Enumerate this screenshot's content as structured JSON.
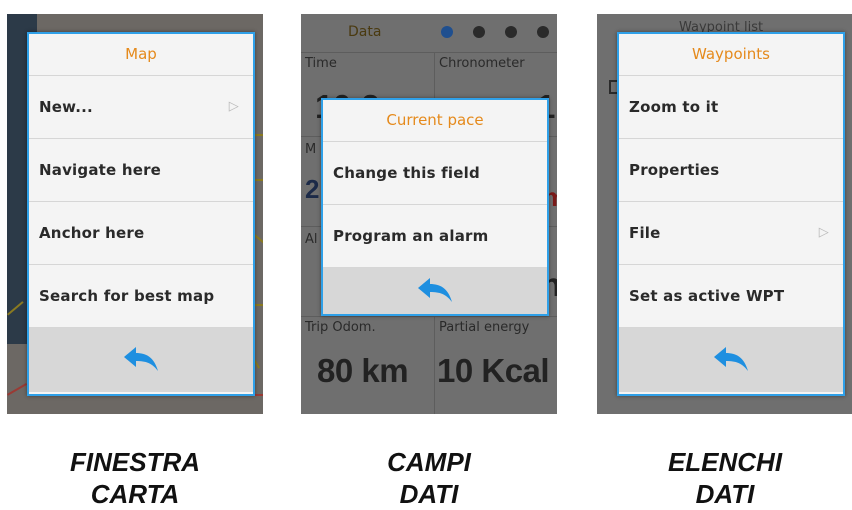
{
  "panels": [
    {
      "dialog_title": "Map",
      "items": [
        {
          "label": "New...",
          "has_submenu": true
        },
        {
          "label": "Navigate here",
          "has_submenu": false
        },
        {
          "label": "Anchor here",
          "has_submenu": false
        },
        {
          "label": "Search for best map",
          "has_submenu": false
        }
      ],
      "caption": [
        "FINESTRA",
        "CARTA"
      ]
    },
    {
      "background": {
        "header": "Data",
        "page_dots": 4,
        "active_dot": 0,
        "labels": [
          "Time",
          "Chronometer",
          "M",
          "Al",
          "Trip Odom.",
          "Partial energy"
        ],
        "partial_values": [
          "10:2",
          "1",
          "2",
          "m",
          "h"
        ],
        "values": [
          "80 km",
          "10 Kcal"
        ]
      },
      "dialog_title": "Current pace",
      "items": [
        {
          "label": "Change this field",
          "has_submenu": false
        },
        {
          "label": "Program an alarm",
          "has_submenu": false
        }
      ],
      "caption": [
        "CAMPI",
        "DATI"
      ]
    },
    {
      "background": {
        "header": "Waypoint list"
      },
      "dialog_title": "Waypoints",
      "items": [
        {
          "label": "Zoom to it",
          "has_submenu": false
        },
        {
          "label": "Properties",
          "has_submenu": false
        },
        {
          "label": "File",
          "has_submenu": true
        },
        {
          "label": "Set as active WPT",
          "has_submenu": false
        }
      ],
      "caption": [
        "ELENCHI",
        "DATI"
      ]
    }
  ],
  "icons": {
    "back": "back-arrow-icon",
    "submenu": "submenu-triangle-icon"
  },
  "colors": {
    "dialog_border": "#2fa0e8",
    "dialog_title": "#e58a1c",
    "back_arrow": "#1e8fe0",
    "active_dot": "#1f4f8f"
  }
}
